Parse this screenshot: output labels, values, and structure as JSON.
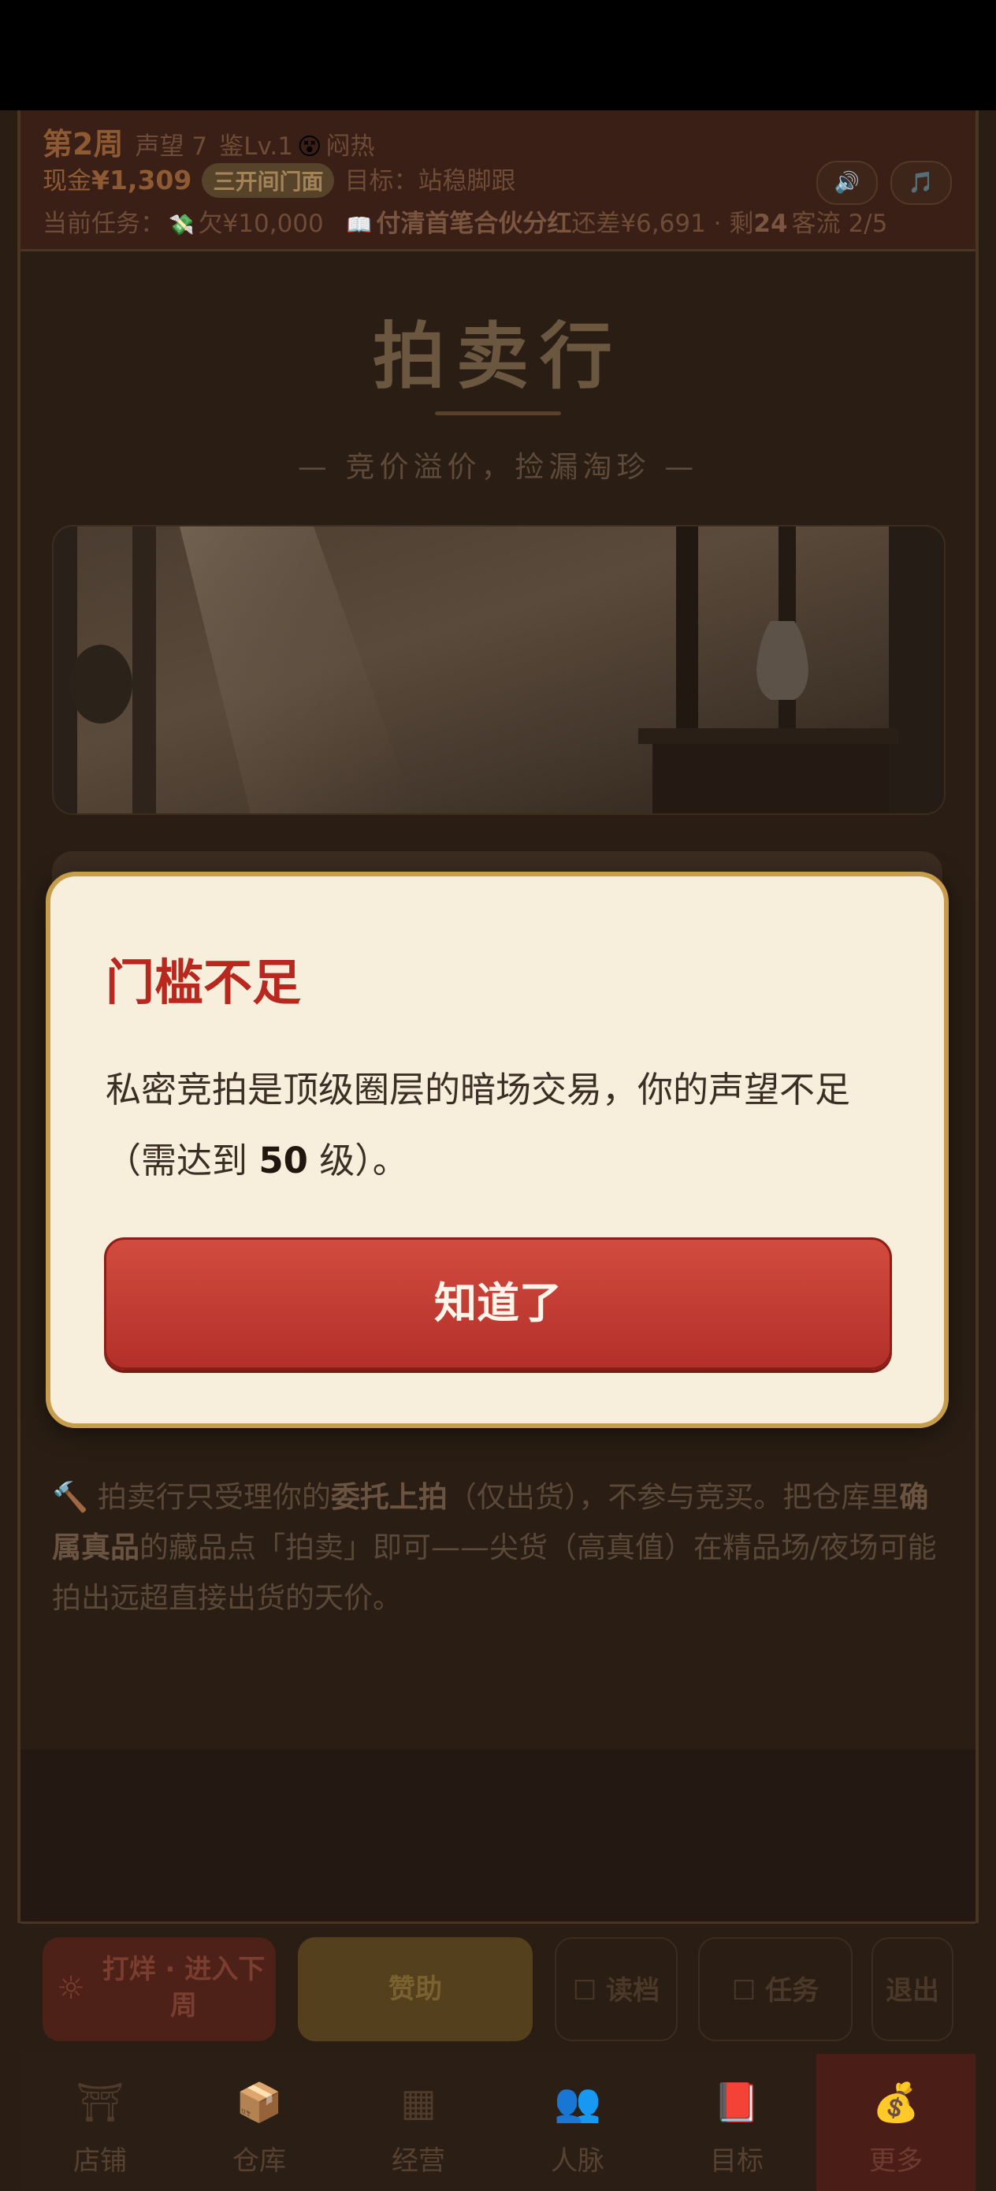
{
  "header": {
    "week": "第2周",
    "fame": "声望 7",
    "appraisal": "鉴Lv.1",
    "mood_icon": "😵",
    "mood": "闷热",
    "cash_label": "现金",
    "cash": "¥1,309",
    "shop_badge": "三开间门面",
    "goal": "目标：站稳脚跟",
    "task_label": "当前任务：",
    "debt_icon": "💸",
    "debt": "欠¥10,000",
    "book_icon": "📖",
    "task_title": "付清首笔合伙分红",
    "task_remaining": "还差¥6,691 · 剩",
    "days_left": "24",
    "customers": "客流 2/5",
    "sound_icon": "🔊",
    "music_icon": "🎵"
  },
  "page": {
    "title": "拍卖行",
    "subtitle": "— 竞价溢价，捡漏淘珍 —"
  },
  "info": {
    "icon": "🔨",
    "text_1": " 拍卖行只受理你的",
    "bold_1": "委托上拍",
    "text_2": "（仅出货），不参与竞买。把仓库里",
    "bold_2": "确属真品",
    "text_3": "的藏品点「拍卖」即可——尖货（高真值）在精品场/夜场可能拍出远超直接出货的天价。"
  },
  "dialog": {
    "title": "门槛不足",
    "body_prefix": "私密竞拍是顶级圈层的暗场交易，你的声望不足（需达到 ",
    "level": "50",
    "body_suffix": " 级）。",
    "button": "知道了"
  },
  "actions": {
    "next_week_icon": "☼",
    "next_week": "打烊 · 进入下周",
    "sponsor": "赞助",
    "save": "☐ 读档",
    "tasks": "☐ 任务",
    "exit": "退出"
  },
  "tabs": [
    {
      "icon": "⛩",
      "label": "店铺"
    },
    {
      "icon": "📦",
      "label": "仓库"
    },
    {
      "icon": "▦",
      "label": "经营"
    },
    {
      "icon": "👥",
      "label": "人脉"
    },
    {
      "icon": "📕",
      "label": "目标"
    },
    {
      "icon": "💰",
      "label": "更多"
    }
  ],
  "colors": {
    "dialog_title": "#b8281f",
    "dialog_button": "#c23c32",
    "dialog_border": "#c79c4b",
    "dialog_bg": "#f7eedc"
  }
}
